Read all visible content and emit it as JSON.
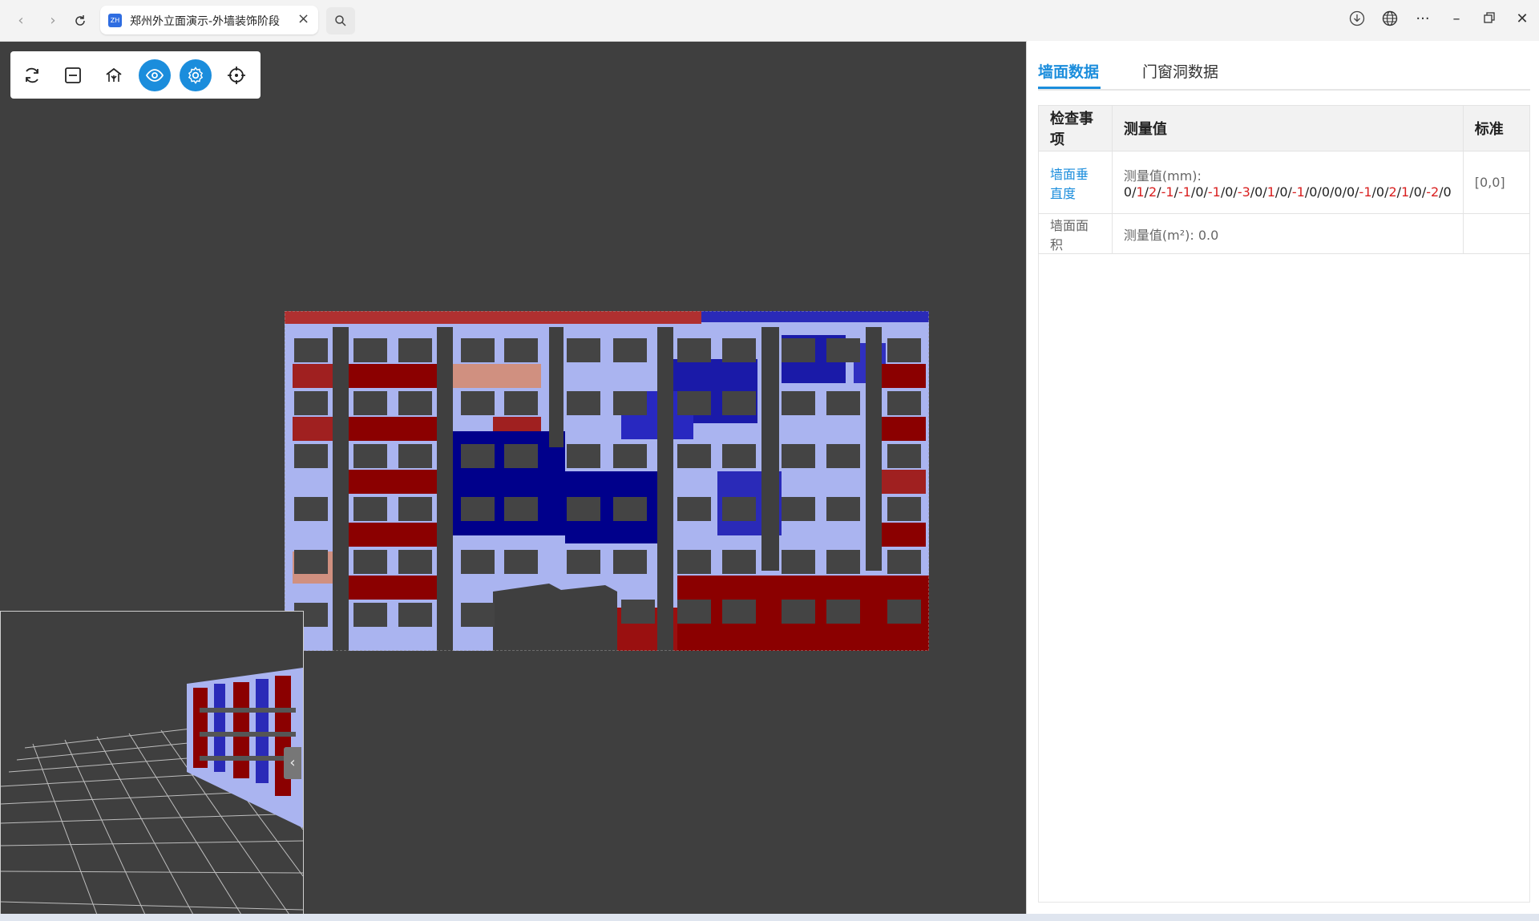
{
  "browser": {
    "tab_title": "郑州外立面演示-外墙装饰阶段",
    "favicon_text": "ZH"
  },
  "toolbar": {
    "tools": [
      {
        "name": "refresh-icon",
        "active": false
      },
      {
        "name": "minus-square-icon",
        "active": false
      },
      {
        "name": "house-icon",
        "active": false
      },
      {
        "name": "eye-icon",
        "active": true
      },
      {
        "name": "gear-icon",
        "active": true
      },
      {
        "name": "crosshair-icon",
        "active": false
      }
    ]
  },
  "colors": {
    "accent": "#1b8ddc",
    "deviation_red": "#8b0000",
    "deviation_blue": "#00008b",
    "light_blue": "#aab4f0",
    "window": "#3f3f3f"
  },
  "panel": {
    "tab_wall": "墙面数据",
    "tab_door": "门窗洞数据",
    "headers": {
      "item": "检查事项",
      "value": "测量值",
      "standard": "标准"
    },
    "rows": [
      {
        "item": "墙面垂直度",
        "label": "测量值(mm): ",
        "values": [
          "0",
          "1",
          "2",
          "-1",
          "-1",
          "0",
          "-1",
          "0",
          "-3",
          "0",
          "1",
          "0",
          "-1",
          "0",
          "0",
          "0",
          "0",
          "-1",
          "0",
          "2",
          "1",
          "0",
          "-2",
          "0"
        ],
        "standard": "[0,0]"
      },
      {
        "item": "墙面面积",
        "label": "测量值(m²): ",
        "value": "0.0",
        "standard": ""
      }
    ]
  }
}
